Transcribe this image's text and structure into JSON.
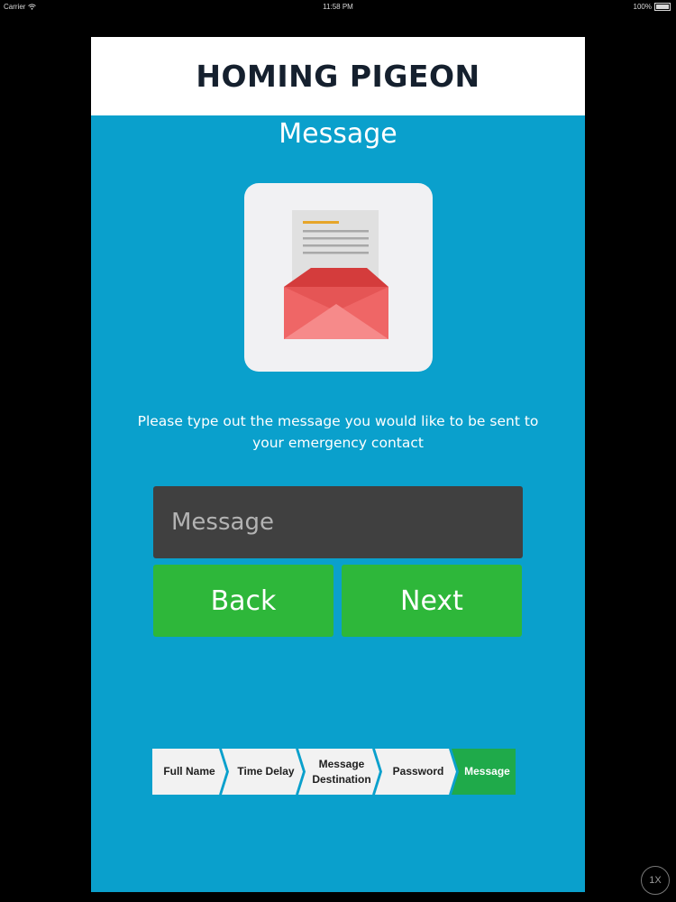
{
  "status_bar": {
    "carrier": "Carrier",
    "time": "11:58 PM",
    "battery": "100%"
  },
  "app": {
    "title": "HOMING PIGEON"
  },
  "page": {
    "title": "Message",
    "instruction": "Please type out the message you would like to be sent to your emergency contact"
  },
  "message_field": {
    "placeholder": "Message",
    "value": ""
  },
  "buttons": {
    "back": "Back",
    "next": "Next"
  },
  "progress": {
    "steps": [
      "Full Name",
      "Time Delay",
      "Message Destination",
      "Password",
      "Message"
    ],
    "active_index": 4
  },
  "zoom": {
    "label": "1X"
  },
  "colors": {
    "background": "#0aa0cc",
    "header": "#ffffff",
    "button": "#2eb73a",
    "input": "#404040",
    "step_active": "#1faa4a",
    "step_inactive": "#f2f2f2"
  },
  "icons": [
    "wifi-icon",
    "battery-icon",
    "envelope-letter-icon"
  ]
}
